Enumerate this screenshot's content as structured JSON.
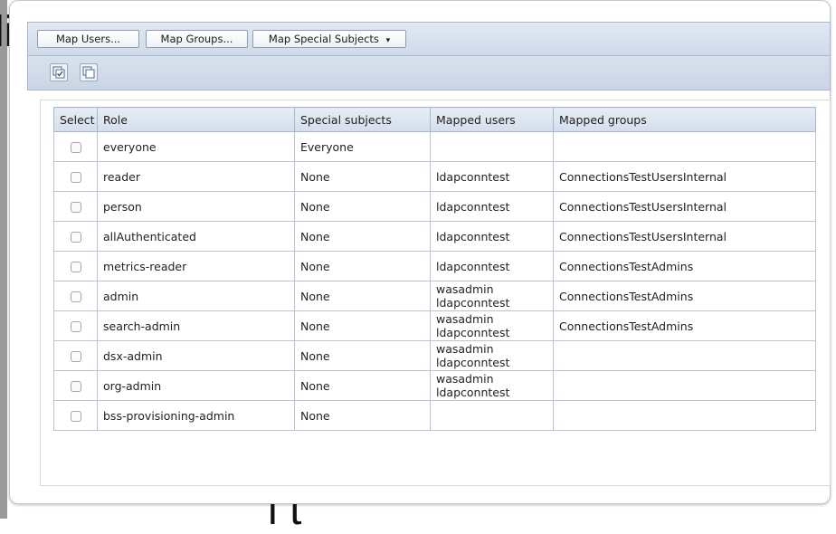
{
  "background_text": {
    "left_glyph": "li",
    "bottom_glyph": "l    t\""
  },
  "toolbar": {
    "map_users_label": "Map Users...",
    "map_groups_label": "Map Groups...",
    "map_special_label": "Map Special Subjects",
    "dropdown_arrow": "▾",
    "icons": [
      "select-all-icon",
      "deselect-all-icon"
    ]
  },
  "table": {
    "headers": {
      "select": "Select",
      "role": "Role",
      "special": "Special subjects",
      "users": "Mapped users",
      "groups": "Mapped groups"
    },
    "rows": [
      {
        "role": "everyone",
        "special": "Everyone",
        "users": [],
        "groups": ""
      },
      {
        "role": "reader",
        "special": "None",
        "users": [
          "ldapconntest"
        ],
        "groups": "ConnectionsTestUsersInternal"
      },
      {
        "role": "person",
        "special": "None",
        "users": [
          "ldapconntest"
        ],
        "groups": "ConnectionsTestUsersInternal"
      },
      {
        "role": "allAuthenticated",
        "special": "None",
        "users": [
          "ldapconntest"
        ],
        "groups": "ConnectionsTestUsersInternal"
      },
      {
        "role": "metrics-reader",
        "special": "None",
        "users": [
          "ldapconntest"
        ],
        "groups": "ConnectionsTestAdmins"
      },
      {
        "role": "admin",
        "special": "None",
        "users": [
          "wasadmin",
          "ldapconntest"
        ],
        "groups": "ConnectionsTestAdmins"
      },
      {
        "role": "search-admin",
        "special": "None",
        "users": [
          "wasadmin",
          "ldapconntest"
        ],
        "groups": "ConnectionsTestAdmins"
      },
      {
        "role": "dsx-admin",
        "special": "None",
        "users": [
          "wasadmin",
          "ldapconntest"
        ],
        "groups": ""
      },
      {
        "role": "org-admin",
        "special": "None",
        "users": [
          "wasadmin",
          "ldapconntest"
        ],
        "groups": ""
      },
      {
        "role": "bss-provisioning-admin",
        "special": "None",
        "users": [],
        "groups": ""
      }
    ]
  },
  "colors": {
    "header_bg": "#d4deec",
    "border": "#a9b7cc",
    "toolbar_bg": "#d3ddeb"
  }
}
